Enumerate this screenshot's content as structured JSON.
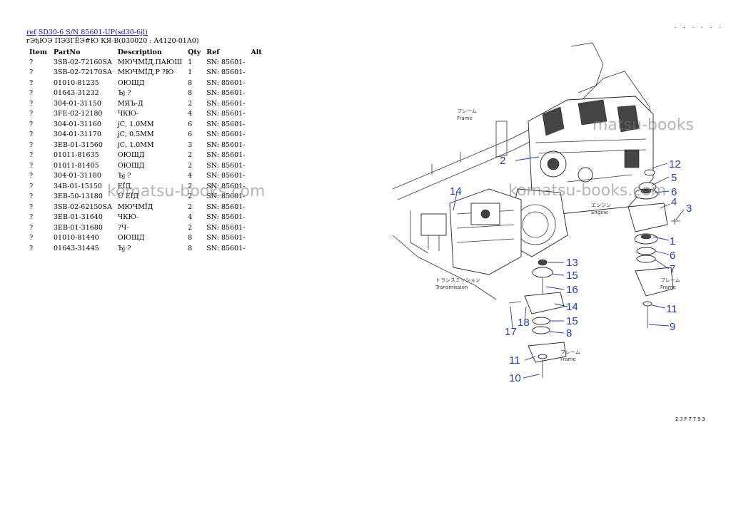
{
  "nav": {
    "ref": "ref",
    "model": "SD30-6 S/N 85601-UP(sd30-6jl)"
  },
  "subtitle": "гЭђЮЭ ПЭЗГЁЭ#Ю КЯ-В(030020 : A4120-01A0)",
  "table": {
    "headers": [
      "Item",
      "PartNo",
      "Description",
      "Qty",
      "Ref",
      "Alt"
    ],
    "rows": [
      [
        "?",
        "3SB-02-72160SA",
        "МЮЧМЇД,ПАЮШ",
        "1",
        "SN: 85601-",
        ""
      ],
      [
        "?",
        "3SB-02-72170SA",
        "МЮЧМЇД,Р ?Ю",
        "1",
        "SN: 85601-",
        ""
      ],
      [
        "?",
        "01010-81235",
        "ОЮЩД",
        "8",
        "SN: 85601-",
        ""
      ],
      [
        "?",
        "01643-31232",
        "Ъј ?",
        "8",
        "SN: 85601-",
        ""
      ],
      [
        "?",
        "304-01-31150",
        "МЯЪ-Д",
        "2",
        "SN: 85601-",
        ""
      ],
      [
        "?",
        "3FE-02-12180",
        "ЧКЮ-",
        "4",
        "SN: 85601-",
        ""
      ],
      [
        "?",
        "304-01-31160",
        "јС, 1.0MM",
        "6",
        "SN: 85601-",
        ""
      ],
      [
        "?",
        "304-01-31170",
        "јС, 0.5MM",
        "6",
        "SN: 85601-",
        ""
      ],
      [
        "?",
        "3EB-01-31560",
        "јС, 1.0MM",
        "3",
        "SN: 85601-",
        ""
      ],
      [
        "?",
        "01011-81635",
        "ОЮЩД",
        "2",
        "SN: 85601-",
        ""
      ],
      [
        "?",
        "01011-81405",
        "ОЮЩД",
        "2",
        "SN: 85601-",
        ""
      ],
      [
        "?",
        "304-01-31180",
        "Ъј ?",
        "4",
        "SN: 85601-",
        ""
      ],
      [
        "?",
        "34B-01-15150",
        "ЕЇД",
        "2",
        "SN: 85601-",
        ""
      ],
      [
        "?",
        "3EB-50-13180",
        "Ü ЕЇД",
        "2",
        "SN: 85601-",
        ""
      ],
      [
        "?",
        "3SB-02-62150SA",
        "МЮЧМЇД",
        "2",
        "SN: 85601-",
        ""
      ],
      [
        "?",
        "3EB-01-31640",
        "ЧКЮ-",
        "4",
        "SN: 85601-",
        ""
      ],
      [
        "?",
        "3EB-01-31680",
        "?Ч-",
        "2",
        "SN: 85601-",
        ""
      ],
      [
        "?",
        "01010-81440",
        "ОЮЩД",
        "8",
        "SN: 85601-",
        ""
      ],
      [
        "?",
        "01643-31445",
        "Ъј ?",
        "8",
        "SN: 85601-",
        ""
      ]
    ]
  },
  "watermark": "komatsu-books.com",
  "watermark_partial": "matsu-books",
  "figure_code": "2JF7793",
  "corner_mark": ". . . . . .",
  "diagram": {
    "labels": [
      "1",
      "2",
      "3",
      "4",
      "5",
      "6",
      "6",
      "7",
      "8",
      "9",
      "10",
      "11",
      "11",
      "12",
      "13",
      "14",
      "14",
      "15",
      "15",
      "16",
      "17",
      "18"
    ],
    "frame_text": "Frame",
    "frame_jp": "フレーム",
    "engine_text": "Engine",
    "engine_jp": "エンジン",
    "transmission_text": "Transmission",
    "transmission_jp": "トランスミッション"
  },
  "colors": {
    "link": "#1a0dab",
    "callout": "#1f3fb0"
  }
}
